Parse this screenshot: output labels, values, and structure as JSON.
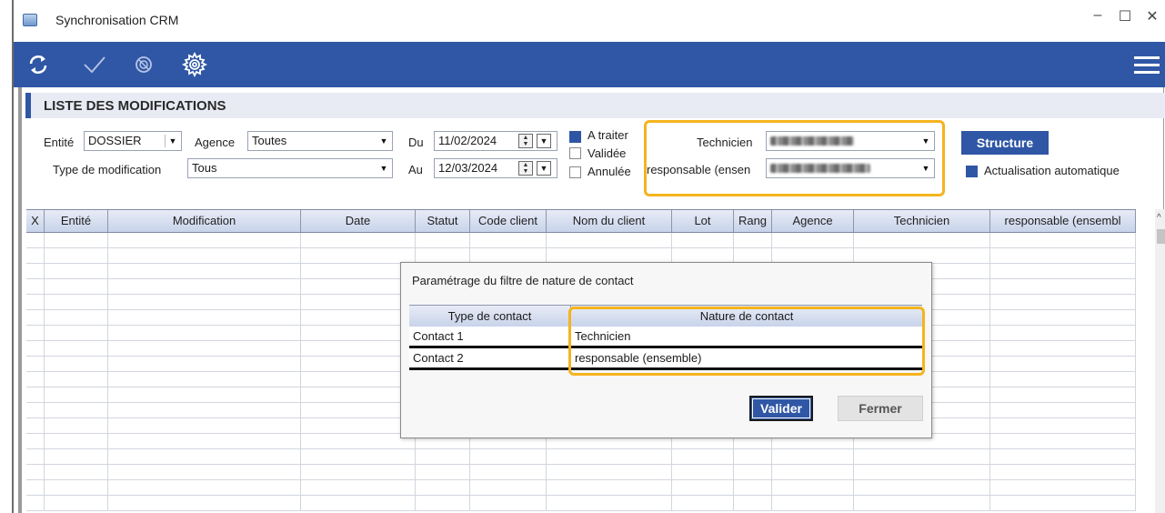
{
  "window": {
    "title": "Synchronisation CRM",
    "controls": {
      "minimize": "–",
      "maximize": "☐",
      "close": "✕"
    }
  },
  "toolbar": {
    "icons": [
      "refresh-icon",
      "check-icon",
      "cancel-icon",
      "settings-icon",
      "menu-icon"
    ],
    "accent_color": "#3057a5"
  },
  "section": {
    "title": "LISTE DES MODIFICATIONS"
  },
  "filters": {
    "entite_label": "Entité",
    "entite_value": "DOSSIER",
    "agence_label": "Agence",
    "agence_value": "Toutes",
    "type_modif_label": "Type de modification",
    "type_modif_value": "Tous",
    "du_label": "Du",
    "du_value": "11/02/2024",
    "au_label": "Au",
    "au_value": "12/03/2024",
    "status_a_traiter": "A traiter",
    "status_validee": "Validée",
    "status_annulee": "Annulée",
    "technicien_label": "Technicien",
    "responsable_label": "responsable (ensen",
    "structure_button": "Structure",
    "auto_refresh_label": "Actualisation automatique"
  },
  "grid": {
    "columns": [
      "X",
      "Entité",
      "Modification",
      "Date",
      "Statut",
      "Code client",
      "Nom du client",
      "Lot",
      "Rang",
      "Agence",
      "Technicien",
      "responsable (ensembl"
    ]
  },
  "dialog": {
    "title": "Paramétrage du filtre de nature de contact",
    "col_type": "Type de contact",
    "col_nature": "Nature de contact",
    "rows": [
      {
        "type": "Contact 1",
        "nature": "Technicien"
      },
      {
        "type": "Contact 2",
        "nature": "responsable (ensemble)"
      }
    ],
    "valider_button": "Valider",
    "fermer_button": "Fermer"
  },
  "highlight_color": "#f5b41e"
}
